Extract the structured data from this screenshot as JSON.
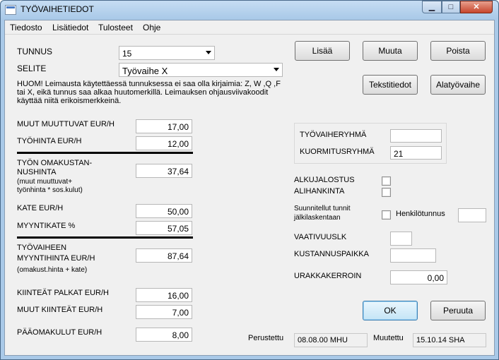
{
  "window": {
    "title": "TYÖVAIHETIEDOT",
    "close_glyph": "✕",
    "min_glyph": "▁",
    "max_glyph": "□"
  },
  "menu": [
    "Tiedosto",
    "Lisätiedot",
    "Tulosteet",
    "Ohje"
  ],
  "tunnus": {
    "label": "TUNNUS",
    "value": "15"
  },
  "selite": {
    "label": "SELITE",
    "value": "Työvaihe X"
  },
  "note": "HUOM! Leimausta käytettäessä tunnuksessa ei saa olla kirjaimia: Z, W ,Q ,F tai X, eikä tunnus saa alkaa huutomerkillä. Leimauksen ohjausviivakoodit käyttää niitä erikoismerkkeinä.",
  "costs": {
    "muut_muuttuvat": {
      "label": "MUUT MUUTTUVAT EUR/H",
      "value": "17,00"
    },
    "tyohinta": {
      "label": "TYÖHINTA EUR/H",
      "value": "12,00"
    },
    "omakustannushinta": {
      "label_1": "TYÖN OMAKUSTAN-",
      "label_2": "NUSHINTA",
      "note_1": "(muut muuttuvat+",
      "note_2": "työnhinta * sos.kulut)",
      "value": "37,64"
    },
    "kate": {
      "label": "KATE EUR/H",
      "value": "50,00"
    },
    "myyntikate": {
      "label": "MYYNTIKATE %",
      "value": "57,05"
    },
    "myyntihinta": {
      "label_1": "TYÖVAIHEEN",
      "label_2": "MYYNTIHINTA EUR/H",
      "note": "(omakust.hinta + kate)",
      "value": "87,64"
    },
    "kiinteat_palkat": {
      "label": "KIINTEÄT PALKAT EUR/H",
      "value": "16,00"
    },
    "muut_kiinteat": {
      "label": "MUUT KIINTEÄT EUR/H",
      "value": "7,00"
    },
    "paaomakulut": {
      "label": "PÄÄOMAKULUT EUR/H",
      "value": "8,00"
    }
  },
  "buttons": {
    "lisaa": "Lisää",
    "muuta": "Muuta",
    "poista": "Poista",
    "tekstitiedot": "Tekstitiedot",
    "alatyovaihe": "Alatyövaihe",
    "ok": "OK",
    "peruuta": "Peruuta"
  },
  "groups": {
    "tyovaiheryhma": {
      "label": "TYÖVAIHERYHMÄ",
      "value": ""
    },
    "kuormitusryhma": {
      "label": "KUORMITUSRYHMÄ",
      "value": "21"
    }
  },
  "checks": {
    "alkujalostus": "ALKUJALOSTUS",
    "alihankinta": "ALIHANKINTA",
    "suunnitellut_1": "Suunnitellut tunnit",
    "suunnitellut_2": "jälkilaskentaan",
    "henkilotunnus": "Henkilötunnus"
  },
  "extra": {
    "vaativuus": {
      "label": "VAATIVUUSLK",
      "value": ""
    },
    "kustannuspaikka": {
      "label": "KUSTANNUSPAIKKA",
      "value": ""
    },
    "urakkakerroin": {
      "label": "URAKKAKERROIN",
      "value": "0,00"
    }
  },
  "footer": {
    "perustettu_label": "Perustettu",
    "perustettu_value": "08.08.00   MHU",
    "muutettu_label": "Muutettu",
    "muutettu_value": "15.10.14   SHA"
  }
}
